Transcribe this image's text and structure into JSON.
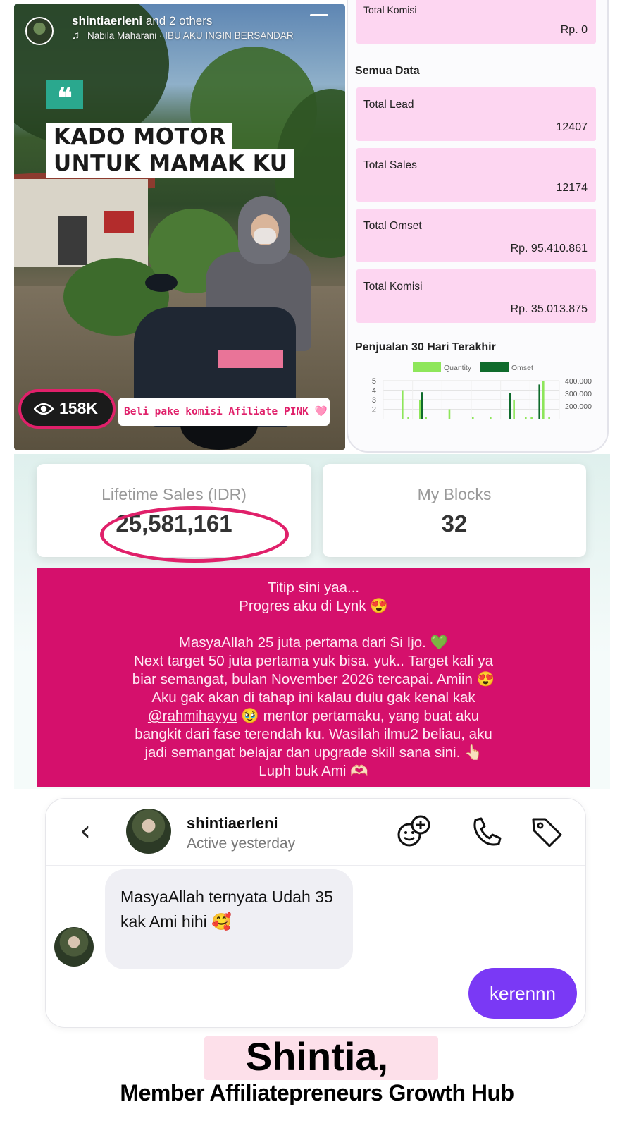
{
  "story": {
    "user": "shintiaerleni",
    "others": "and 2 others",
    "music": "Nabila Maharani · IBU AKU INGIN BERSANDAR",
    "quote_mark": "❝",
    "headline_line1": "KADO MOTOR",
    "headline_line2": "UNTUK MAMAK KU",
    "views": "158K",
    "note": "Beli pake komisi Afiliate PINK 🩷",
    "icons": [
      "music-icon",
      "eye-icon",
      "menu-icon"
    ]
  },
  "dashboard": {
    "top_card": {
      "label": "Total Komisi",
      "value": "Rp. 0"
    },
    "section_title": "Semua Data",
    "cards": [
      {
        "label": "Total Lead",
        "value": "12407"
      },
      {
        "label": "Total Sales",
        "value": "12174"
      },
      {
        "label": "Total Omset",
        "value": "Rp. 95.410.861"
      },
      {
        "label": "Total Komisi",
        "value": "Rp. 35.013.875"
      }
    ],
    "chart_title": "Penjualan 30 Hari Terakhir"
  },
  "chart_data": {
    "type": "bar",
    "title": "Penjualan 30 Hari Terakhir",
    "series": [
      {
        "name": "Quantity",
        "color": "#8ee65a",
        "axis": "left",
        "values": [
          0,
          0,
          0,
          4,
          1,
          0,
          3,
          1,
          0,
          0,
          0,
          2,
          0,
          0,
          0,
          1,
          0,
          0,
          1,
          0,
          0,
          0,
          3,
          0,
          1,
          1,
          0,
          5,
          1,
          0
        ]
      },
      {
        "name": "Omset",
        "color": "#0f6b2c",
        "axis": "right",
        "values": [
          0,
          0,
          0,
          0,
          0,
          0,
          310000,
          0,
          0,
          0,
          0,
          0,
          0,
          0,
          0,
          0,
          0,
          0,
          0,
          0,
          0,
          300000,
          0,
          0,
          0,
          0,
          370000,
          0,
          0,
          0
        ]
      }
    ],
    "y_left_ticks": [
      "2",
      "3",
      "4",
      "5"
    ],
    "y_left_range": [
      1,
      5
    ],
    "y_right_ticks": [
      "200.000",
      "300.000",
      "400.000"
    ],
    "y_right_range": [
      100000,
      400000
    ],
    "legend": "top",
    "grid": true
  },
  "lynk": {
    "lifetime_label": "Lifetime Sales (IDR)",
    "lifetime_value": "25,581,161",
    "blocks_label": "My Blocks",
    "blocks_value": "32",
    "story_lines": [
      "Titip sini yaa...",
      "Progres aku di Lynk 😍",
      "",
      "MasyaAllah 25 juta pertama  dari Si Ijo. 💚",
      "Next target 50 juta pertama yuk bisa. yuk.. Target kali ya",
      "biar semangat, bulan November 2026 tercapai. Amiin 😍",
      "Aku gak akan di tahap ini kalau dulu gak kenal kak",
      "@rahmihayyu 🥹 mentor pertamaku, yang buat aku",
      "bangkit dari fase terendah ku. Wasilah ilmu2 beliau, aku",
      "jadi semangat belajar dan upgrade skill sana sini. 👆🏻",
      "Luph buk Ami 🫶🏻"
    ]
  },
  "dm": {
    "back": "‹",
    "name": "shintiaerleni",
    "status": "Active yesterday",
    "incoming": "MasyaAllah ternyata Udah 35 kak Ami hihi 🥰",
    "outgoing": "kerennn",
    "icons": [
      "add-friend-icon",
      "phone-icon",
      "tag-icon"
    ]
  },
  "footer": {
    "name": "Shintia,",
    "subtitle": "Member Affiliatepreneurs Growth Hub",
    "highlight_color": "#fde0ea"
  }
}
